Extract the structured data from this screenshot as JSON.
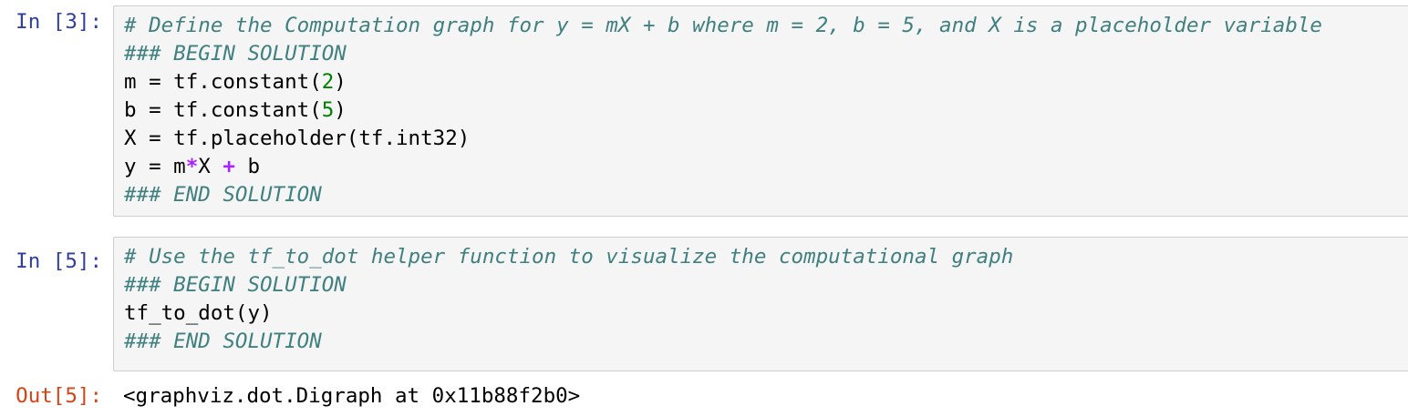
{
  "cells": [
    {
      "prompt": "In [3]:",
      "lines": [
        {
          "comment": "# Define the Computation graph for y = mX + b where m = 2, b = 5, and X is a placeholder variable"
        },
        {
          "comment": "### BEGIN SOLUTION"
        },
        {
          "pre": "m = tf.constant(",
          "num": "2",
          "post": ")"
        },
        {
          "pre": "b = tf.constant(",
          "num": "5",
          "post": ")"
        },
        {
          "text": "X = tf.placeholder(tf.int32)"
        },
        {
          "p1": "y = m",
          "op1": "*",
          "p2": "X ",
          "op2": "+",
          "p3": " b"
        },
        {
          "comment": "### END SOLUTION"
        }
      ]
    },
    {
      "prompt": "In [5]:",
      "lines": [
        {
          "comment": "# Use the tf_to_dot helper function to visualize the computational graph"
        },
        {
          "comment": "### BEGIN SOLUTION"
        },
        {
          "text": "tf_to_dot(y)"
        },
        {
          "comment": "### END SOLUTION"
        }
      ]
    }
  ],
  "output": {
    "prompt": "Out[5]:",
    "text": "<graphviz.dot.Digraph at 0x11b88f2b0>"
  }
}
